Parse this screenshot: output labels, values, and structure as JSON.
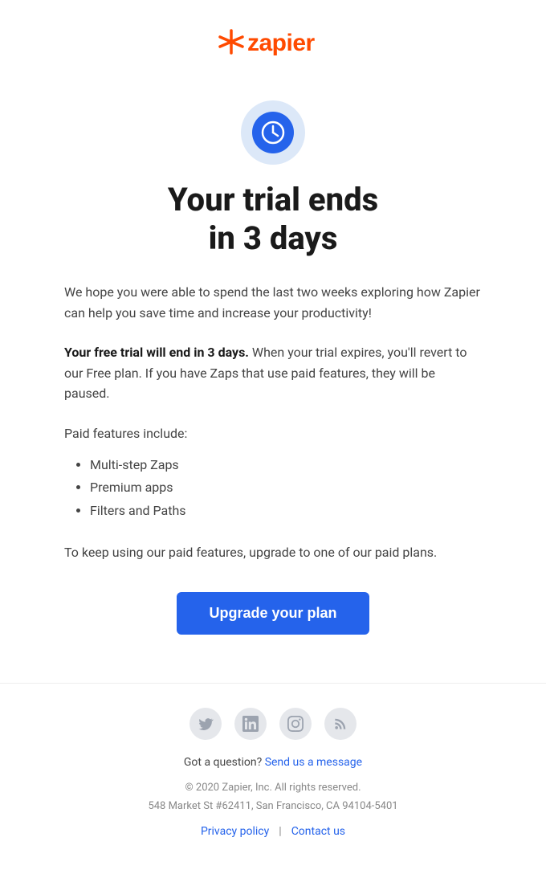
{
  "header": {
    "logo_text": "zapier",
    "logo_asterisk": "✳"
  },
  "hero": {
    "headline_line1": "Your trial ends",
    "headline_line2": "in 3 days",
    "icon_label": "clock-icon"
  },
  "body": {
    "intro": "We hope you were able to spend the last two weeks exploring how Zapier can help you save time and increase your productivity!",
    "trial_warning_bold": "Your free trial will end in 3 days.",
    "trial_warning_rest": " When your trial expires, you'll revert to our Free plan. If you have Zaps that use paid features, they will be paused.",
    "paid_features_label": "Paid features include:",
    "features": [
      "Multi-step Zaps",
      "Premium apps",
      "Filters and Paths"
    ],
    "upgrade_prompt": "To keep using our paid features, upgrade to one of our paid plans."
  },
  "cta": {
    "upgrade_button": "Upgrade your plan"
  },
  "footer": {
    "question_text": "Got a question?",
    "send_message_link": "Send us a message",
    "copyright": "© 2020 Zapier, Inc. All rights reserved.",
    "address": "548 Market St #62411, San Francisco, CA 94104-5401",
    "privacy_policy_link": "Privacy policy",
    "contact_us_link": "Contact us",
    "social_links": {
      "twitter": "twitter-icon",
      "linkedin": "linkedin-icon",
      "instagram": "instagram-icon",
      "rss": "rss-icon"
    }
  }
}
